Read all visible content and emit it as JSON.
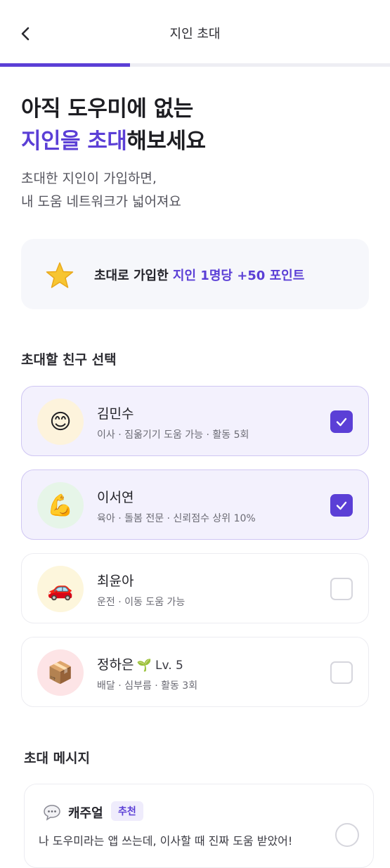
{
  "header": {
    "title": "지인 초대",
    "progress": 0.333
  },
  "hero": {
    "line1": "아직 도우미에 없는",
    "line2_accent": "지인을 초대",
    "line2_rest": "해보세요",
    "sub_line1": "초대한 지인이 가입하면,",
    "sub_line2": "내 도움 네트워크가 넓어져요"
  },
  "reward": {
    "prefix": "초대로 가입한 ",
    "accent": "지인 1명당 +50 포인트",
    "icon": "star-icon"
  },
  "friends_section": {
    "title": "초대할 친구 선택"
  },
  "friends": [
    {
      "name": "김민수",
      "level": "",
      "desc": "이사 · 짐옮기기 도움 가능 · 활동 5회",
      "emoji": "😊",
      "avatar_color": "#fdf3dc",
      "selected": true
    },
    {
      "name": "이서연",
      "level": "",
      "desc": "육아 · 돌봄 전문 · 신뢰점수 상위 10%",
      "emoji": "💪",
      "avatar_color": "#e6f5e8",
      "selected": true
    },
    {
      "name": "최윤아",
      "level": "",
      "desc": "운전 · 이동 도움 가능",
      "emoji": "🚗",
      "avatar_color": "#fdf6dc",
      "selected": false
    },
    {
      "name": "정하은",
      "level": "🌱 Lv. 5",
      "desc": "배달 · 심부름 · 활동 3회",
      "emoji": "📦",
      "avatar_color": "#fde4e6",
      "selected": false
    }
  ],
  "message_section": {
    "title": "초대 메시지"
  },
  "message_option": {
    "label": "캐주얼",
    "badge": "추천",
    "text": "나 도우미라는 앱 쓰는데, 이사할 때 진짜 도움 받았어!",
    "icon": "speech-bubble-icon",
    "selected": false
  },
  "colors": {
    "accent": "#5b3fd6",
    "selected_bg": "#f3f1fd"
  }
}
